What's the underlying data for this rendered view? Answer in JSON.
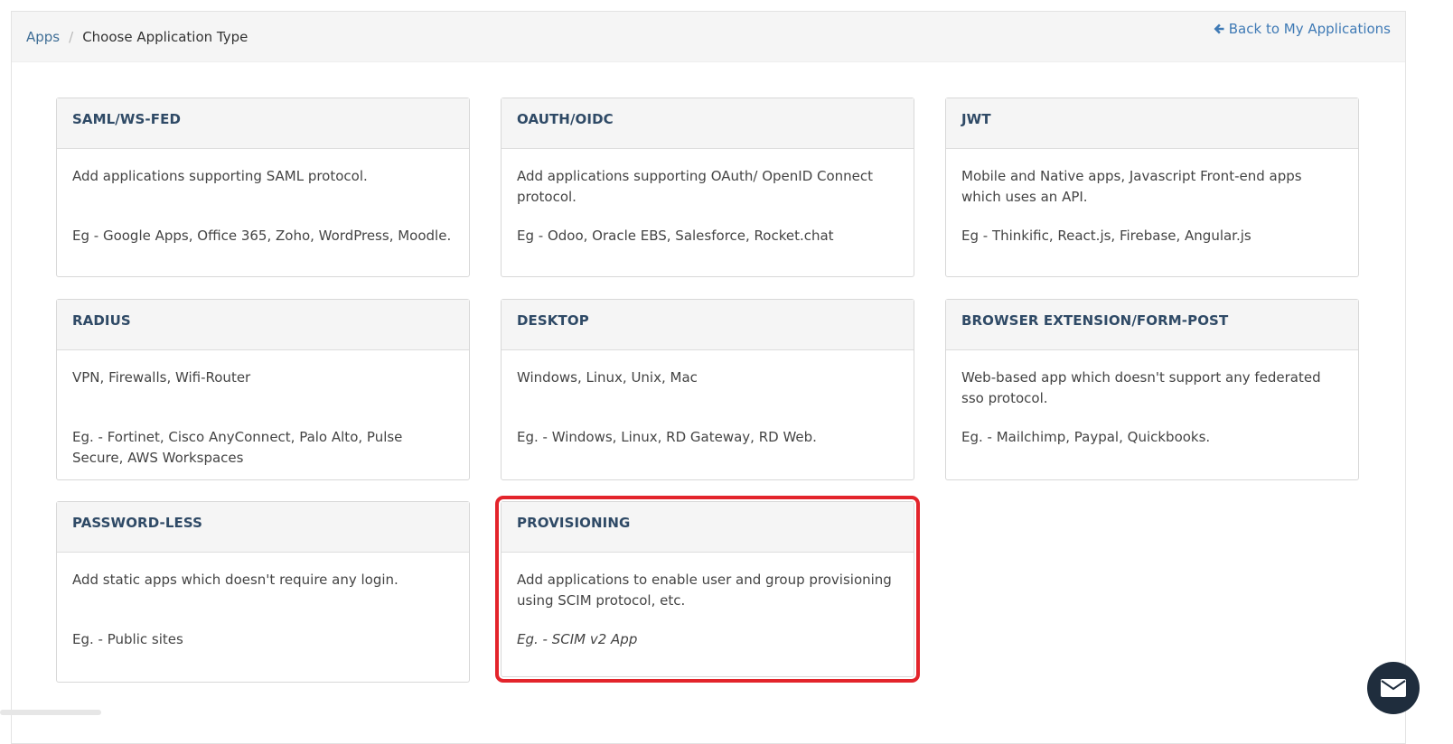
{
  "breadcrumb": {
    "root": "Apps",
    "separator": "/",
    "current": "Choose Application Type"
  },
  "back_link": {
    "label": "Back to My Applications",
    "icon": "arrow-left-icon"
  },
  "cards": [
    {
      "title": "SAML/WS-FED",
      "description": "Add applications supporting SAML protocol.",
      "example": "Eg - Google Apps, Office 365, Zoho, WordPress, Moodle."
    },
    {
      "title": "OAUTH/OIDC",
      "description": "Add applications supporting OAuth/ OpenID Connect protocol.",
      "example": "Eg - Odoo, Oracle EBS, Salesforce, Rocket.chat"
    },
    {
      "title": "JWT",
      "description": "Mobile and Native apps, Javascript Front-end apps which uses an API.",
      "example": "Eg - Thinkific, React.js, Firebase, Angular.js"
    },
    {
      "title": "RADIUS",
      "description": "VPN, Firewalls, Wifi-Router",
      "example": "Eg. - Fortinet, Cisco AnyConnect, Palo Alto, Pulse Secure, AWS Workspaces"
    },
    {
      "title": "DESKTOP",
      "description": "Windows, Linux, Unix, Mac",
      "example": "Eg. - Windows, Linux, RD Gateway, RD Web."
    },
    {
      "title": "BROWSER EXTENSION/FORM-POST",
      "description": "Web-based app which doesn't support any federated sso protocol.",
      "example": "Eg. - Mailchimp, Paypal, Quickbooks."
    },
    {
      "title": "PASSWORD-LESS",
      "description": "Add static apps which doesn't require any login.",
      "example": "Eg. - Public sites"
    },
    {
      "title": "PROVISIONING",
      "description": "Add applications to enable user and group provisioning using SCIM protocol, etc.",
      "example": "Eg. - SCIM v2 App",
      "highlighted": true
    }
  ],
  "chat": {
    "icon": "envelope-icon"
  },
  "colors": {
    "link": "#3f7ab5",
    "card_title": "#2f4a66",
    "highlight": "#e3242b",
    "chat_bg": "#1f2d3d"
  }
}
